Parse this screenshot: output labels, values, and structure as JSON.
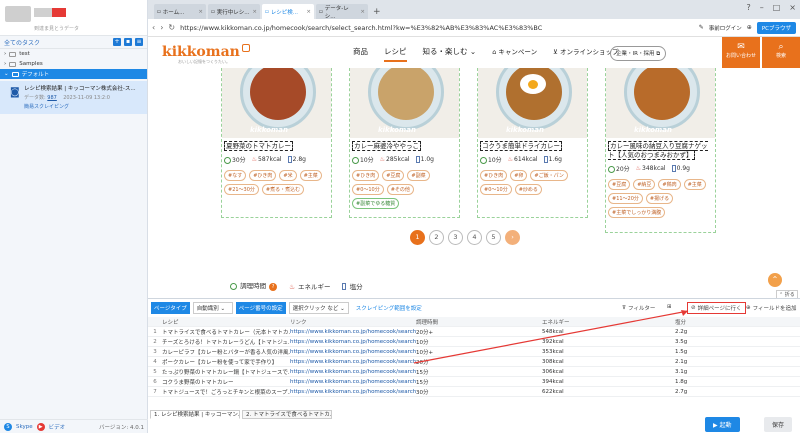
{
  "sidebar": {
    "sub_label": "到達ま見とうデータ",
    "all_tasks": "全てのタスク",
    "tree": [
      "test",
      "Samples",
      "デフォルト"
    ],
    "task": {
      "title": "レシピ検索結果 | キッコーマン株式会社-ス...",
      "count_label": "データ数:",
      "count": "987",
      "date": "2023-11-09 13:2:0",
      "mode": "簡易スクレイピング"
    },
    "footer": {
      "skype": "Skype",
      "video": "ビデオ",
      "version": "バージョン: 4.0.1"
    }
  },
  "browser": {
    "tabs": [
      {
        "label": "ホーム..."
      },
      {
        "label": "実行中レシ..."
      },
      {
        "label": "レシピ検..."
      },
      {
        "label": "データ-レシ..."
      }
    ],
    "url": "https://www.kikkoman.co.jp/homecook/search/select_search.html?kw=%E3%82%AB%E3%83%AC%E3%83%BC",
    "login": "事前ログイン",
    "pc_browser": "PCブラウザ"
  },
  "site": {
    "logo": "kikkoman",
    "tagline": "おいしい記憶をつくりたい。",
    "nav": [
      "商品",
      "レシピ",
      "知る・楽しむ",
      "キャンペーン",
      "オンラインショップ"
    ],
    "corp": "企業・IR・採用",
    "contact": "お問い合わせ",
    "search": "検索",
    "cards": [
      {
        "title": "夏野菜のトマトカレー",
        "time": "30分",
        "kcal": "587kcal",
        "salt": "2.8g",
        "tags": [
          "#なす",
          "#ひき肉",
          "#米",
          "#主菜",
          "#21〜30分",
          "#煮る・煮込む"
        ],
        "color": "#a64a28"
      },
      {
        "title": "カレー麻婆冷ややっこ",
        "time": "10分",
        "kcal": "285kcal",
        "salt": "1.0g",
        "tags": [
          "#ひき肉",
          "#豆腐",
          "#副菜",
          "#0〜10分",
          "#その他",
          "#副菜でゆる糖質"
        ],
        "color": "#c9a36a"
      },
      {
        "title": "コクうま簡単ドライカレー",
        "time": "10分",
        "kcal": "614kcal",
        "salt": "1.6g",
        "tags": [
          "#ひき肉",
          "#卵",
          "#ご飯・パン",
          "#0〜10分",
          "#炒める"
        ],
        "color": "#b0702f"
      },
      {
        "title": "カレー風味の納豆入り豆腐ナゲット【人気のおつまみおかず】",
        "time": "20分",
        "kcal": "348kcal",
        "salt": "0.9g",
        "tags": [
          "#豆腐",
          "#納豆",
          "#鶏肉",
          "#主菜",
          "#11〜20分",
          "#揚げる",
          "#主菜でしっかり満腹"
        ],
        "color": "#b86b2a"
      }
    ],
    "pages": [
      "1",
      "2",
      "3",
      "4",
      "5"
    ],
    "legend": {
      "time": "調理時間",
      "energy": "エネルギー",
      "salt": "塩分"
    },
    "fold": "折る"
  },
  "toolbar": {
    "page_type": "ページタイプ",
    "page_type_val": "自動識別",
    "page_no": "ページ番号の設定",
    "page_no_val": "選択クリック など",
    "range": "スクレイピング範囲を設定",
    "filter": "フィルター",
    "detail": "詳細ページに行く",
    "field": "フィールドを追加"
  },
  "table": {
    "headers": [
      "レシピ",
      "リンク",
      "調理時間",
      "エネルギー",
      "塩分"
    ],
    "rows": [
      [
        "トマトライスで食べるトマトカレー（元本トマトカ...",
        "https://www.kikkoman.co.jp/homecook/search/recipe/...",
        "20分+",
        "548kcal",
        "2.2g"
      ],
      [
        "チーズとろける！トマトカレーうどん【トマトジュ...",
        "https://www.kikkoman.co.jp/homecook/search/recipe/...",
        "10分",
        "392kcal",
        "3.5g"
      ],
      [
        "カレーピラフ【カレー粉とバターが香る人気の洋風...",
        "https://www.kikkoman.co.jp/homecook/search/recipe/...",
        "10分+",
        "353kcal",
        "1.5g"
      ],
      [
        "ポークカレー【カレー粉を使って家で手作り】",
        "https://www.kikkoman.co.jp/homecook/search/recipe/...",
        "20分",
        "308kcal",
        "2.1g"
      ],
      [
        "たっぷり野菜のトマトカレー鍋【トマトジュースで...",
        "https://www.kikkoman.co.jp/homecook/search/recipe/...",
        "15分",
        "306kcal",
        "3.1g"
      ],
      [
        "コクうま野菜のトマトカレー",
        "https://www.kikkoman.co.jp/homecook/search/recipe/...",
        "15分",
        "394kcal",
        "1.8g"
      ],
      [
        "トマトジュースで！ごろっとチキンと根菜のスープ...",
        "https://www.kikkoman.co.jp/homecook/search/recipe/...",
        "30分",
        "622kcal",
        "2.7g"
      ]
    ]
  },
  "bottom_tabs": [
    "1. レシピ検索結果 | キッコーマン...",
    "2. トマトライスで食べるトマトカ..."
  ],
  "buttons": {
    "run": "▶ 起動",
    "save": "保存"
  }
}
